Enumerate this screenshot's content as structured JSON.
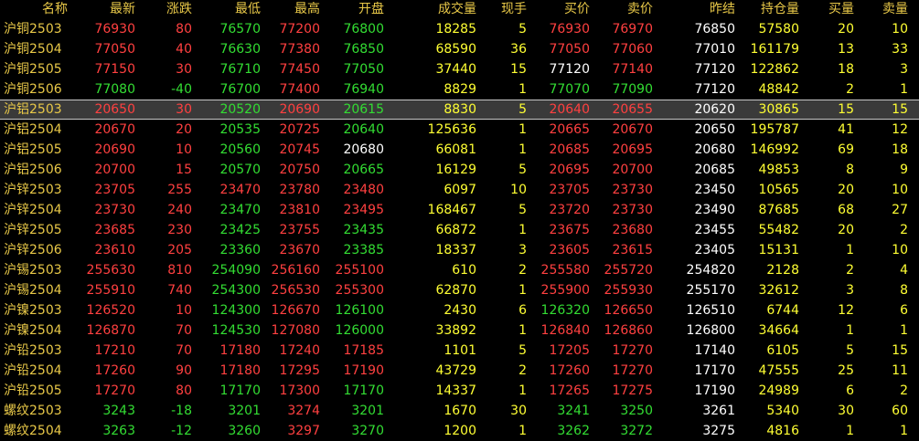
{
  "colors": {
    "background": "#000000",
    "header": "#e8c848",
    "up": "#ff4040",
    "down": "#33dd33",
    "neutral": "#ffffff",
    "volume": "#ffff33",
    "selected_row_bg": "#3a3a3a"
  },
  "headers": {
    "name": "名称",
    "last": "最新",
    "change": "涨跌",
    "low": "最低",
    "high": "最高",
    "open": "开盘",
    "volume": "成交量",
    "current_hand": "现手",
    "bid": "买价",
    "ask": "卖价",
    "prev_settle": "昨结",
    "open_interest": "持仓量",
    "bid_volume": "买量",
    "ask_volume": "卖量"
  },
  "selected_index": 4,
  "rows": [
    {
      "name": "沪铜2503",
      "last": "76930",
      "change": "80",
      "low": "76570",
      "high": "77200",
      "open": "76800",
      "volume": "18285",
      "cur": "5",
      "bid": "76930",
      "ask": "76970",
      "prev": "76850",
      "oi": "57580",
      "bidv": "20",
      "askv": "10",
      "c": {
        "last": "red",
        "change": "red",
        "low": "green",
        "high": "red",
        "open": "green",
        "bid": "red",
        "ask": "red"
      }
    },
    {
      "name": "沪铜2504",
      "last": "77050",
      "change": "40",
      "low": "76630",
      "high": "77380",
      "open": "76850",
      "volume": "68590",
      "cur": "36",
      "bid": "77050",
      "ask": "77060",
      "prev": "77010",
      "oi": "161179",
      "bidv": "13",
      "askv": "33",
      "c": {
        "last": "red",
        "change": "red",
        "low": "green",
        "high": "red",
        "open": "green",
        "bid": "red",
        "ask": "red"
      }
    },
    {
      "name": "沪铜2505",
      "last": "77150",
      "change": "30",
      "low": "76710",
      "high": "77450",
      "open": "77050",
      "volume": "37440",
      "cur": "15",
      "bid": "77120",
      "ask": "77140",
      "prev": "77120",
      "oi": "122862",
      "bidv": "18",
      "askv": "3",
      "c": {
        "last": "red",
        "change": "red",
        "low": "green",
        "high": "red",
        "open": "green",
        "bid": "white",
        "ask": "red"
      }
    },
    {
      "name": "沪铜2506",
      "last": "77080",
      "change": "-40",
      "low": "76700",
      "high": "77400",
      "open": "76940",
      "volume": "8829",
      "cur": "1",
      "bid": "77070",
      "ask": "77090",
      "prev": "77120",
      "oi": "48842",
      "bidv": "2",
      "askv": "1",
      "c": {
        "last": "green",
        "change": "green",
        "low": "green",
        "high": "red",
        "open": "green",
        "bid": "green",
        "ask": "green"
      }
    },
    {
      "name": "沪铝2503",
      "last": "20650",
      "change": "30",
      "low": "20520",
      "high": "20690",
      "open": "20615",
      "volume": "8830",
      "cur": "5",
      "bid": "20640",
      "ask": "20655",
      "prev": "20620",
      "oi": "30865",
      "bidv": "15",
      "askv": "15",
      "c": {
        "last": "red",
        "change": "red",
        "low": "green",
        "high": "red",
        "open": "green",
        "bid": "red",
        "ask": "red"
      }
    },
    {
      "name": "沪铝2504",
      "last": "20670",
      "change": "20",
      "low": "20535",
      "high": "20725",
      "open": "20640",
      "volume": "125636",
      "cur": "1",
      "bid": "20665",
      "ask": "20670",
      "prev": "20650",
      "oi": "195787",
      "bidv": "41",
      "askv": "12",
      "c": {
        "last": "red",
        "change": "red",
        "low": "green",
        "high": "red",
        "open": "green",
        "bid": "red",
        "ask": "red"
      }
    },
    {
      "name": "沪铝2505",
      "last": "20690",
      "change": "10",
      "low": "20560",
      "high": "20745",
      "open": "20680",
      "volume": "66081",
      "cur": "1",
      "bid": "20685",
      "ask": "20695",
      "prev": "20680",
      "oi": "146992",
      "bidv": "69",
      "askv": "18",
      "c": {
        "last": "red",
        "change": "red",
        "low": "green",
        "high": "red",
        "open": "white",
        "bid": "red",
        "ask": "red"
      }
    },
    {
      "name": "沪铝2506",
      "last": "20700",
      "change": "15",
      "low": "20570",
      "high": "20750",
      "open": "20665",
      "volume": "16129",
      "cur": "5",
      "bid": "20695",
      "ask": "20700",
      "prev": "20685",
      "oi": "49853",
      "bidv": "8",
      "askv": "9",
      "c": {
        "last": "red",
        "change": "red",
        "low": "green",
        "high": "red",
        "open": "green",
        "bid": "red",
        "ask": "red"
      }
    },
    {
      "name": "沪锌2503",
      "last": "23705",
      "change": "255",
      "low": "23470",
      "high": "23780",
      "open": "23480",
      "volume": "6097",
      "cur": "10",
      "bid": "23705",
      "ask": "23730",
      "prev": "23450",
      "oi": "10565",
      "bidv": "20",
      "askv": "10",
      "c": {
        "last": "red",
        "change": "red",
        "low": "red",
        "high": "red",
        "open": "red",
        "bid": "red",
        "ask": "red"
      }
    },
    {
      "name": "沪锌2504",
      "last": "23730",
      "change": "240",
      "low": "23470",
      "high": "23810",
      "open": "23495",
      "volume": "168467",
      "cur": "5",
      "bid": "23720",
      "ask": "23730",
      "prev": "23490",
      "oi": "87685",
      "bidv": "68",
      "askv": "27",
      "c": {
        "last": "red",
        "change": "red",
        "low": "green",
        "high": "red",
        "open": "red",
        "bid": "red",
        "ask": "red"
      }
    },
    {
      "name": "沪锌2505",
      "last": "23685",
      "change": "230",
      "low": "23425",
      "high": "23755",
      "open": "23435",
      "volume": "66872",
      "cur": "1",
      "bid": "23675",
      "ask": "23680",
      "prev": "23455",
      "oi": "55482",
      "bidv": "20",
      "askv": "2",
      "c": {
        "last": "red",
        "change": "red",
        "low": "green",
        "high": "red",
        "open": "green",
        "bid": "red",
        "ask": "red"
      }
    },
    {
      "name": "沪锌2506",
      "last": "23610",
      "change": "205",
      "low": "23360",
      "high": "23670",
      "open": "23385",
      "volume": "18337",
      "cur": "3",
      "bid": "23605",
      "ask": "23615",
      "prev": "23405",
      "oi": "15131",
      "bidv": "1",
      "askv": "10",
      "c": {
        "last": "red",
        "change": "red",
        "low": "green",
        "high": "red",
        "open": "green",
        "bid": "red",
        "ask": "red"
      }
    },
    {
      "name": "沪锡2503",
      "last": "255630",
      "change": "810",
      "low": "254090",
      "high": "256160",
      "open": "255100",
      "volume": "610",
      "cur": "2",
      "bid": "255580",
      "ask": "255720",
      "prev": "254820",
      "oi": "2128",
      "bidv": "2",
      "askv": "4",
      "c": {
        "last": "red",
        "change": "red",
        "low": "green",
        "high": "red",
        "open": "red",
        "bid": "red",
        "ask": "red"
      }
    },
    {
      "name": "沪锡2504",
      "last": "255910",
      "change": "740",
      "low": "254300",
      "high": "256530",
      "open": "255300",
      "volume": "62870",
      "cur": "1",
      "bid": "255900",
      "ask": "255930",
      "prev": "255170",
      "oi": "32612",
      "bidv": "3",
      "askv": "8",
      "c": {
        "last": "red",
        "change": "red",
        "low": "green",
        "high": "red",
        "open": "red",
        "bid": "red",
        "ask": "red"
      }
    },
    {
      "name": "沪镍2503",
      "last": "126520",
      "change": "10",
      "low": "124300",
      "high": "126670",
      "open": "126100",
      "volume": "2430",
      "cur": "6",
      "bid": "126320",
      "ask": "126650",
      "prev": "126510",
      "oi": "6744",
      "bidv": "12",
      "askv": "6",
      "c": {
        "last": "red",
        "change": "red",
        "low": "green",
        "high": "red",
        "open": "green",
        "bid": "green",
        "ask": "red"
      }
    },
    {
      "name": "沪镍2504",
      "last": "126870",
      "change": "70",
      "low": "124530",
      "high": "127080",
      "open": "126000",
      "volume": "33892",
      "cur": "1",
      "bid": "126840",
      "ask": "126860",
      "prev": "126800",
      "oi": "34664",
      "bidv": "1",
      "askv": "1",
      "c": {
        "last": "red",
        "change": "red",
        "low": "green",
        "high": "red",
        "open": "green",
        "bid": "red",
        "ask": "red"
      }
    },
    {
      "name": "沪铅2503",
      "last": "17210",
      "change": "70",
      "low": "17180",
      "high": "17240",
      "open": "17185",
      "volume": "1101",
      "cur": "5",
      "bid": "17205",
      "ask": "17270",
      "prev": "17140",
      "oi": "6105",
      "bidv": "5",
      "askv": "15",
      "c": {
        "last": "red",
        "change": "red",
        "low": "red",
        "high": "red",
        "open": "red",
        "bid": "red",
        "ask": "red"
      }
    },
    {
      "name": "沪铅2504",
      "last": "17260",
      "change": "90",
      "low": "17180",
      "high": "17295",
      "open": "17190",
      "volume": "43729",
      "cur": "2",
      "bid": "17260",
      "ask": "17270",
      "prev": "17170",
      "oi": "47555",
      "bidv": "25",
      "askv": "11",
      "c": {
        "last": "red",
        "change": "red",
        "low": "red",
        "high": "red",
        "open": "red",
        "bid": "red",
        "ask": "red"
      }
    },
    {
      "name": "沪铅2505",
      "last": "17270",
      "change": "80",
      "low": "17170",
      "high": "17300",
      "open": "17170",
      "volume": "14337",
      "cur": "1",
      "bid": "17265",
      "ask": "17275",
      "prev": "17190",
      "oi": "24989",
      "bidv": "6",
      "askv": "2",
      "c": {
        "last": "red",
        "change": "red",
        "low": "green",
        "high": "red",
        "open": "green",
        "bid": "red",
        "ask": "red"
      }
    },
    {
      "name": "螺纹2503",
      "last": "3243",
      "change": "-18",
      "low": "3201",
      "high": "3274",
      "open": "3201",
      "volume": "1670",
      "cur": "30",
      "bid": "3241",
      "ask": "3250",
      "prev": "3261",
      "oi": "5340",
      "bidv": "30",
      "askv": "60",
      "c": {
        "last": "green",
        "change": "green",
        "low": "green",
        "high": "red",
        "open": "green",
        "bid": "green",
        "ask": "green"
      }
    },
    {
      "name": "螺纹2504",
      "last": "3263",
      "change": "-12",
      "low": "3260",
      "high": "3297",
      "open": "3270",
      "volume": "1200",
      "cur": "1",
      "bid": "3262",
      "ask": "3272",
      "prev": "3275",
      "oi": "4816",
      "bidv": "1",
      "askv": "1",
      "c": {
        "last": "green",
        "change": "green",
        "low": "green",
        "high": "red",
        "open": "green",
        "bid": "green",
        "ask": "green"
      }
    }
  ]
}
